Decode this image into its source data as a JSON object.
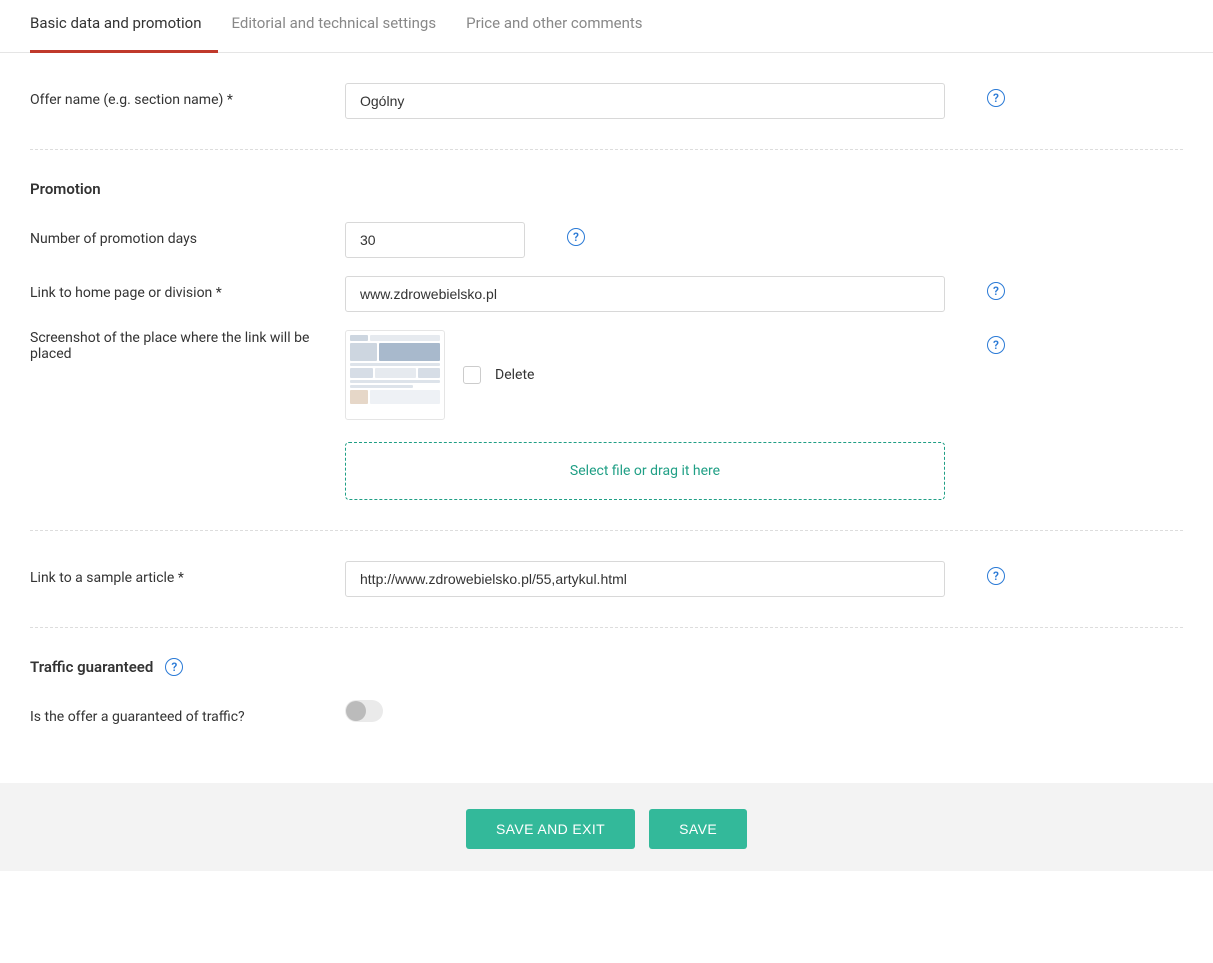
{
  "tabs": {
    "basic": "Basic data and promotion",
    "editorial": "Editorial and technical settings",
    "price": "Price and other comments"
  },
  "fields": {
    "offer_name": {
      "label": "Offer name (e.g. section name) *",
      "value": "Ogólny"
    },
    "promotion_heading": "Promotion",
    "promo_days": {
      "label": "Number of promotion days",
      "value": "30"
    },
    "home_link": {
      "label": "Link to home page or division *",
      "value": "www.zdrowebielsko.pl"
    },
    "screenshot": {
      "label": "Screenshot of the place where the link will be placed"
    },
    "delete_label": "Delete",
    "dropzone": "Select file or drag it here",
    "sample_article": {
      "label": "Link to a sample article *",
      "value": "http://www.zdrowebielsko.pl/55,artykul.html"
    },
    "traffic_heading": "Traffic guaranteed",
    "traffic_toggle_label": "Is the offer a guaranteed of traffic?"
  },
  "buttons": {
    "save_exit": "SAVE AND EXIT",
    "save": "SAVE"
  }
}
